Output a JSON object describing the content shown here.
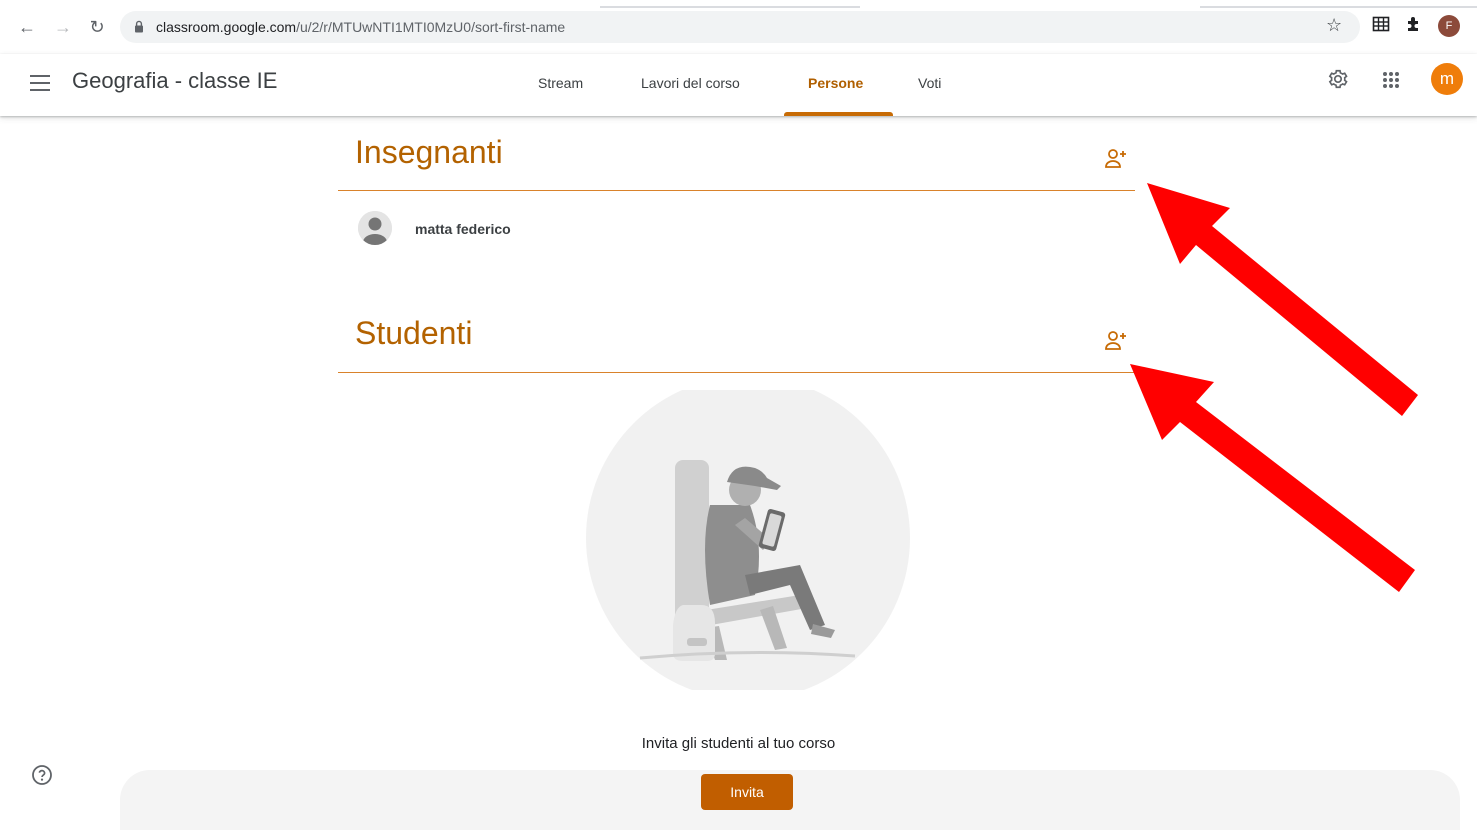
{
  "browser": {
    "url_host": "classroom.google.com",
    "url_path": "/u/2/r/MTUwNTI1MTI0MzU0/sort-first-name",
    "profile_initial": "F"
  },
  "header": {
    "class_title": "Geografia - classe IE",
    "tabs": [
      {
        "label": "Stream"
      },
      {
        "label": "Lavori del corso"
      },
      {
        "label": "Persone"
      },
      {
        "label": "Voti"
      }
    ],
    "active_tab": "Persone",
    "avatar_initial": "m",
    "accent_color": "#c76b05"
  },
  "teachers": {
    "title": "Insegnanti",
    "people": [
      {
        "name": "matta federico"
      }
    ]
  },
  "students": {
    "title": "Studenti",
    "empty_message": "Invita gli studenti al tuo corso",
    "invite_button": "Invita"
  },
  "icons": [
    "back-arrow-icon",
    "forward-arrow-icon",
    "reload-icon",
    "lock-icon",
    "star-icon",
    "grid-extension-icon",
    "puzzle-extension-icon",
    "menu-icon",
    "settings-gear-icon",
    "apps-grid-icon",
    "add-person-icon",
    "help-icon"
  ],
  "annotations": {
    "arrow_color": "#ff0000"
  }
}
